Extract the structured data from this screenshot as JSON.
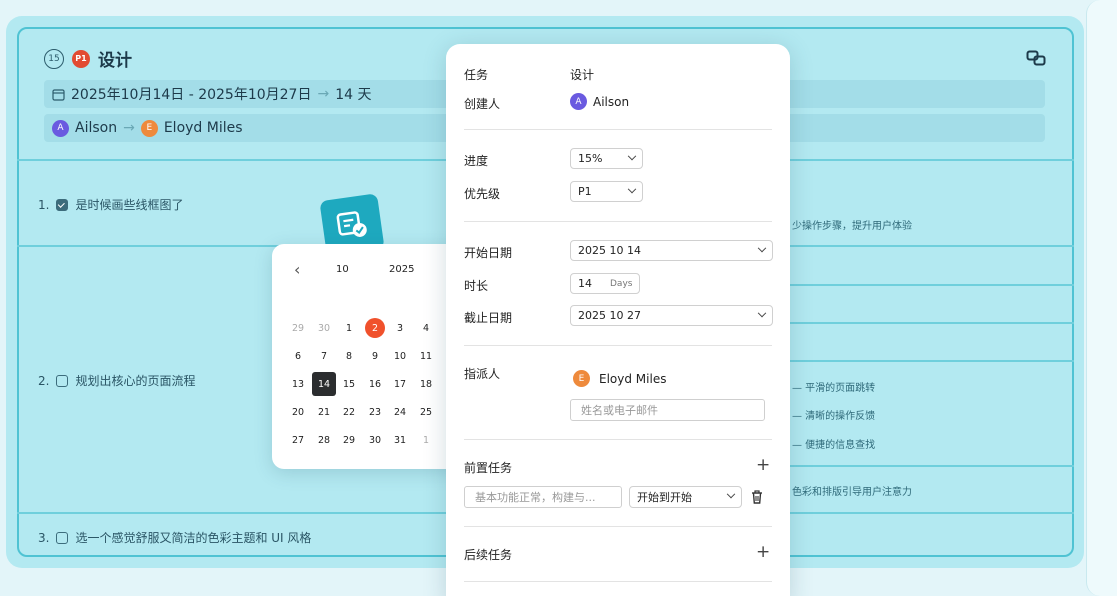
{
  "header": {
    "day_badge": "15",
    "priority_badge": "P1",
    "title": "设计",
    "date_range": "2025年10月14日 - 2025年10月27日",
    "duration": "14 天",
    "from_user": "Ailson",
    "from_initial": "A",
    "to_user": "Eloyd Miles",
    "to_initial": "E",
    "arrow": "→"
  },
  "todos": [
    {
      "num": "1.",
      "text": "是时候画些线框图了",
      "checked": true
    },
    {
      "num": "2.",
      "text": "规划出核心的页面流程",
      "checked": false
    },
    {
      "num": "3.",
      "text": "选一个感觉舒服又简洁的色彩主题和 UI 风格",
      "checked": false
    }
  ],
  "notes": {
    "n1": "少操作步骤，提升用户体验",
    "n2": "— 平滑的页面跳转",
    "n3": "— 清晰的操作反馈",
    "n4": "— 便捷的信息查找",
    "n5": "色彩和排版引导用户注意力"
  },
  "calendar": {
    "prev": "‹",
    "month": "10",
    "year": "2025",
    "rows": [
      [
        "29",
        "30",
        "1",
        "2",
        "3",
        "4"
      ],
      [
        "6",
        "7",
        "8",
        "9",
        "10",
        "11"
      ],
      [
        "13",
        "14",
        "15",
        "16",
        "17",
        "18"
      ],
      [
        "20",
        "21",
        "22",
        "23",
        "24",
        "25"
      ],
      [
        "27",
        "28",
        "29",
        "30",
        "31",
        "1"
      ]
    ]
  },
  "panel": {
    "task_label": "任务",
    "task_value": "设计",
    "creator_label": "创建人",
    "creator_initial": "A",
    "creator_name": "Ailson",
    "progress_label": "进度",
    "progress_value": "15%",
    "priority_label": "优先级",
    "priority_value": "P1",
    "start_label": "开始日期",
    "start_value": "2025  10  14",
    "duration_label": "时长",
    "duration_value": "14",
    "duration_unit": "Days",
    "end_label": "截止日期",
    "end_value": "2025  10  27",
    "assignee_label": "指派人",
    "assignee_initial": "E",
    "assignee_name": "Eloyd Miles",
    "assignee_placeholder": "姓名或电子邮件",
    "predecessor_label": "前置任务",
    "predecessor_placeholder": "基本功能正常，构建与...",
    "predecessor_type": "开始到开始",
    "successor_label": "后续任务",
    "plus": "+"
  },
  "colors": {
    "accent": "#1ea9bf",
    "today": "#f0512c",
    "priority": "#e24b32",
    "avatar_a": "#6a5ae0",
    "avatar_e": "#ee8a3c"
  }
}
